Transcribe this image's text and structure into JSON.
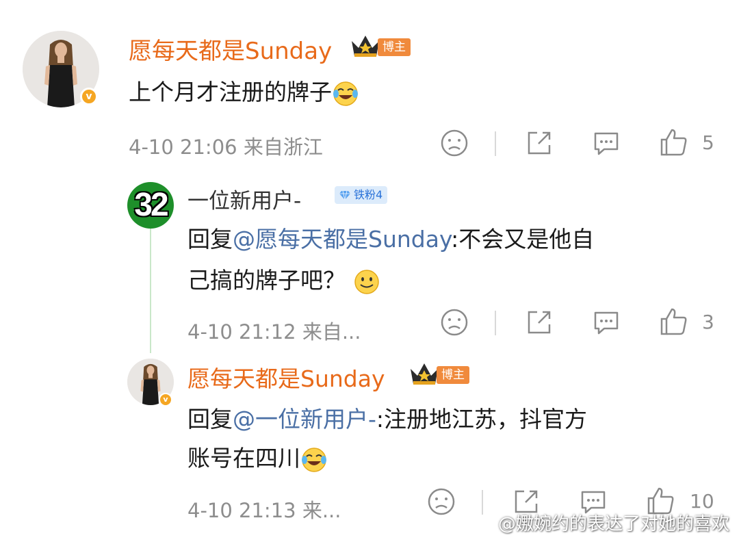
{
  "comments": [
    {
      "name": "愿每天都是Sunday",
      "tag": "博主",
      "text": "上个月才注册的牌子",
      "time": "4-10 21:06",
      "location": "来自浙江",
      "likes": "5"
    },
    {
      "avatar_number": "32",
      "name": "一位新用户-",
      "fan_badge": "铁粉4",
      "reply_prefix": "回复",
      "mention": "@愿每天都是Sunday",
      "text_line1": ":不会又是他自",
      "text_line2": "己搞的牌子吧？",
      "time": "4-10 21:12",
      "location": "来自...",
      "likes": "3"
    },
    {
      "name": "愿每天都是Sunday",
      "tag": "博主",
      "reply_prefix": "回复",
      "mention": "@一位新用户-",
      "text_line1": ":注册地江苏，抖官方",
      "text_line2": "账号在四川",
      "time": "4-10 21:13",
      "location": "来...",
      "likes": "10"
    }
  ],
  "watermark": "@嫐婉约的表达了对她的喜欢",
  "colors": {
    "name": "#e86a1a",
    "mention": "#4a6fa5",
    "meta": "#8d8d8d",
    "tag": "#f08a3c"
  }
}
